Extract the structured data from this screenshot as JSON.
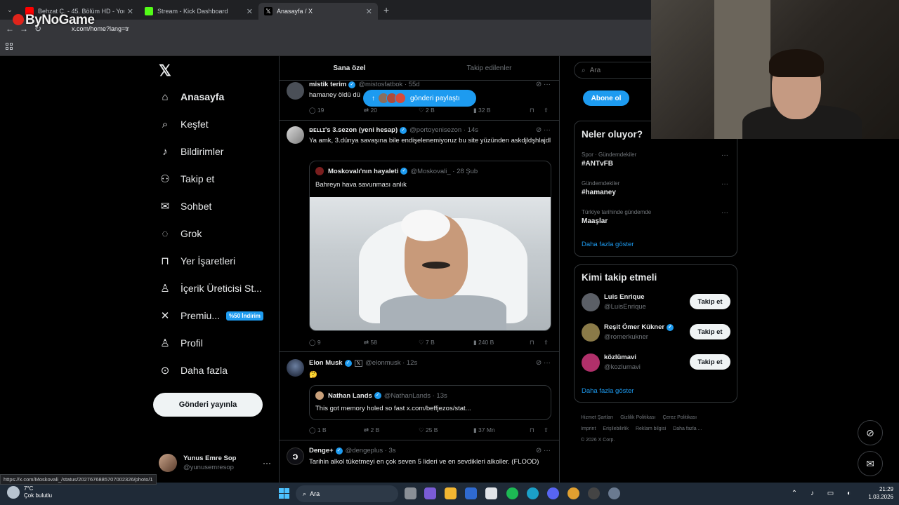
{
  "browser": {
    "tabs": [
      {
        "title": "Behzat Ç. - 45. Bölüm HD - You",
        "color": "#ff0000"
      },
      {
        "title": "Stream - Kick Dashboard",
        "color": "#53fc18"
      },
      {
        "title": "Anasayfa / X",
        "color": "#ffffff"
      }
    ],
    "url": "x.com/home?lang=tr",
    "watermark": "ByNoGame"
  },
  "leftnav": {
    "items": [
      {
        "label": "Anasayfa",
        "icon": "home-icon",
        "glyph": "⌂"
      },
      {
        "label": "Keşfet",
        "icon": "search-icon",
        "glyph": "⌕"
      },
      {
        "label": "Bildirimler",
        "icon": "bell-icon",
        "glyph": "♫"
      },
      {
        "label": "Takip et",
        "icon": "person-add-icon",
        "glyph": "⚇"
      },
      {
        "label": "Sohbet",
        "icon": "mail-icon",
        "glyph": "✉"
      },
      {
        "label": "Grok",
        "icon": "grok-icon",
        "glyph": "◌"
      },
      {
        "label": "Yer İşaretleri",
        "icon": "bookmark-icon",
        "glyph": "⊓"
      },
      {
        "label": "İçerik Üreticisi St...",
        "icon": "creator-icon",
        "glyph": "♙"
      },
      {
        "label": "Premiu...",
        "icon": "x-premium-icon",
        "glyph": "✕",
        "badge": "%50 İndirim"
      },
      {
        "label": "Profil",
        "icon": "profile-icon",
        "glyph": "♙"
      },
      {
        "label": "Daha fazla",
        "icon": "more-circle-icon",
        "glyph": "⊙"
      }
    ],
    "post_button": "Gönderi yayınla",
    "account": {
      "name": "Yunus Emre Sop",
      "handle": "@yunusemresop"
    }
  },
  "main": {
    "tabs": [
      "Sana özel",
      "Takip edilenler"
    ],
    "new_posts_pill": "gönderi paylaştı",
    "tweets": [
      {
        "name": "mistik terim",
        "handle": "@mistosfatbok · 55d",
        "text": "hamaney öldü dü",
        "stats": {
          "reply": "19",
          "retweet": "20",
          "like": "2 B",
          "views": "32 B"
        }
      },
      {
        "name": "ʙᴇʟʟɪ's 3.sezon (yeni hesap)",
        "handle": "@portoyenisezon · 14s",
        "text": "Ya amk, 3.dünya savaşına bile endişelenemiyoruz bu site yüzünden askdjldşhlajdl",
        "quote": {
          "name": "Moskovalı'nın hayaleti",
          "handle": "@Moskovali_ · 28 Şub",
          "text": "Bahreyn hava savunması anlık"
        },
        "stats": {
          "reply": "9",
          "retweet": "58",
          "like": "7 B",
          "views": "240 B"
        }
      },
      {
        "name": "Elon Musk",
        "handle": "@elonmusk · 12s",
        "text": "🤔",
        "quote": {
          "name": "Nathan Lands",
          "handle": "@NathanLands · 13s",
          "text": "This got memory holed so fast x.com/beffjezos/stat..."
        },
        "stats": {
          "reply": "1 B",
          "retweet": "2 B",
          "like": "25 B",
          "views": "37 Mn"
        }
      },
      {
        "name": "Denge+",
        "handle": "@dengeplus · 3s",
        "text": "Tarihin alkol tüketmeyi en çok seven 5 lideri ve en sevdikleri alkoller. (FLOOD)"
      }
    ]
  },
  "right": {
    "search_placeholder": "Ara",
    "subscribe": "Abone ol",
    "trends_title": "Neler oluyor?",
    "trends": [
      {
        "category": "Spor · Gündemdekiler",
        "name": "#ANTvFB"
      },
      {
        "category": "Gündemdekiler",
        "name": "#hamaney"
      },
      {
        "category": "Türkiye tarihinde gündemde",
        "name": "Maaşlar"
      }
    ],
    "trends_more": "Daha fazla göster",
    "who_title": "Kimi takip etmeli",
    "who": [
      {
        "name": "Luis Enrique",
        "handle": "@LuisEnrique",
        "verified": false
      },
      {
        "name": "Reşit Ömer Kükner",
        "handle": "@romerkukner",
        "verified": true
      },
      {
        "name": "közlümavi",
        "handle": "@kozlumavi",
        "verified": false
      }
    ],
    "follow_label": "Takip et",
    "who_more": "Daha fazla göster",
    "footer": [
      "Hizmet Şartları",
      "Gizlilik Politikası",
      "Çerez Politikası",
      "Imprint",
      "Erişilebilirlik",
      "Reklam bilgisi",
      "Daha fazla ...",
      "© 2026 X Corp."
    ]
  },
  "status_url": "https://x.com/Moskovali_/status/2027676885707002326/photo/1",
  "taskbar": {
    "weather_temp": "7°C",
    "weather_desc": "Çok bulutlu",
    "search": "Ara",
    "time": "21:29",
    "date": "1.03.2026"
  }
}
